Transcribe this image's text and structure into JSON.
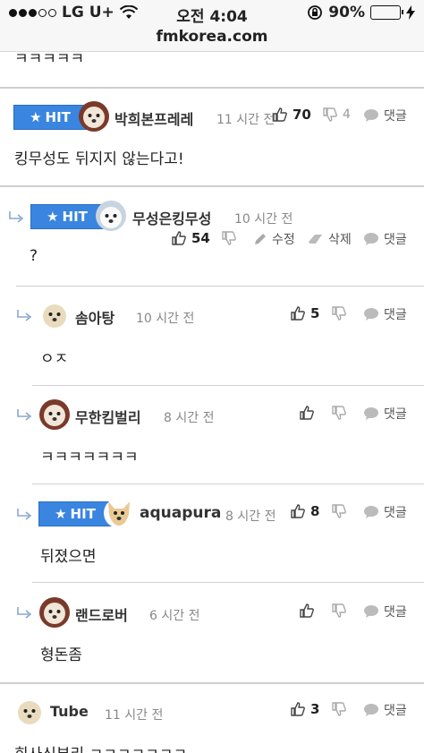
{
  "status": {
    "carrier": "LG U+",
    "time": "오전 4:04",
    "battery": "90%",
    "battery_level": 0.9,
    "url": "fmkorea.com"
  },
  "prev_text": "ㅋㅋㅋㅋㅋ",
  "hit_label": "HIT",
  "labels": {
    "reply": "댓글",
    "edit": "수정",
    "delete": "삭제"
  },
  "comments": [
    {
      "nick": "박희본프레레",
      "time": "11 시간 전",
      "likes": "70",
      "dislikes": "4",
      "text": "킹무성도 뒤지지 않는다고!"
    },
    {
      "nick": "무성은킹무성",
      "time": "10 시간 전",
      "likes": "54",
      "text": "?"
    },
    {
      "nick": "솜아탕",
      "time": "10 시간 전",
      "likes": "5",
      "text": "ㅇㅈ"
    },
    {
      "nick": "무한킴벌리",
      "time": "8 시간 전",
      "text": "ㅋㅋㅋㅋㅋㅋㅋ"
    },
    {
      "nick": "aquapura",
      "time": "8 시간 전",
      "likes": "8",
      "text": "뒤졌으면"
    },
    {
      "nick": "랜드로버",
      "time": "6 시간 전",
      "text": "형돈좀"
    },
    {
      "nick": "Tube",
      "time": "11 시간 전",
      "likes": "3",
      "text": "회사신부리 ㅋㅋㅋㅋㅋㅋㅋ"
    }
  ],
  "icons": [
    "wifi-icon",
    "lock-rotation-icon",
    "charging-icon",
    "star-icon",
    "thumbs-up-icon",
    "thumbs-down-icon",
    "speech-bubble-icon",
    "pencil-icon",
    "eraser-icon",
    "reply-arrow-icon"
  ],
  "colors": {
    "hit_badge": "#3a85e0",
    "battery": "#4cd964"
  }
}
